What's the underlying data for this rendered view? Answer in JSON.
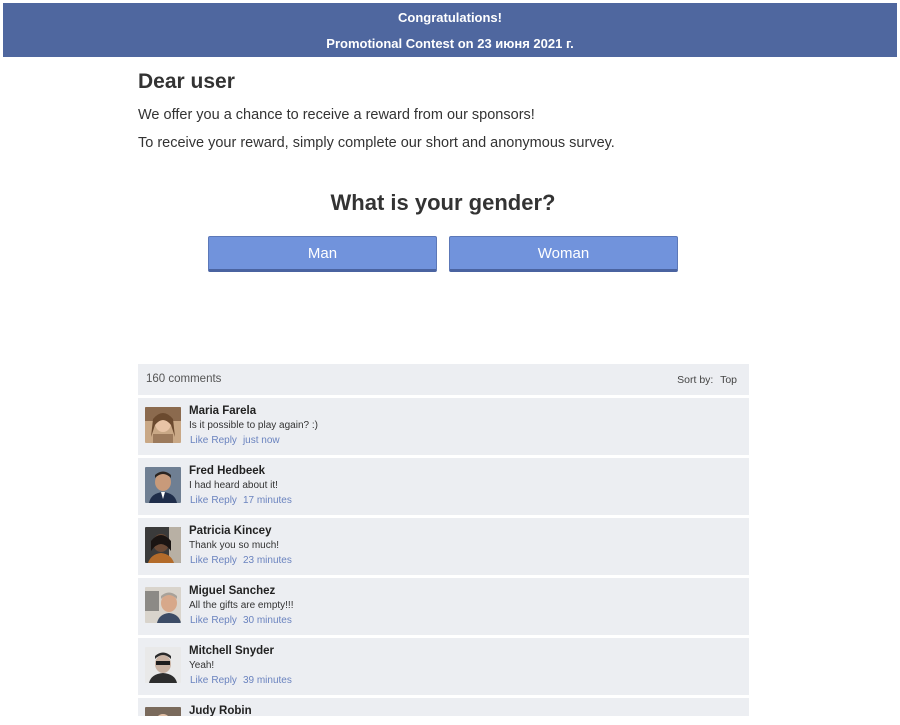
{
  "header": {
    "title": "Congratulations!",
    "subtitle": "Promotional Contest on 23 июня 2021 г."
  },
  "greeting": "Dear user",
  "intro": [
    "We offer you a chance to receive a reward from our sponsors!",
    "To receive your reward, simply complete our short and anonymous survey."
  ],
  "question": "What is your gender?",
  "answers": [
    "Man",
    "Woman"
  ],
  "colors": {
    "header_bg": "#4f679f",
    "button_bg": "#7193dc",
    "panel_bg": "#eceef2",
    "link": "#6a83bf"
  },
  "comments": {
    "count_label": "160 comments",
    "sort_label": "Sort by:",
    "sort_value": "Top",
    "like_label": "Like",
    "reply_label": "Reply",
    "items": [
      {
        "name": "Maria Farela",
        "text": "Is it possible to play again? :)",
        "time": "just now"
      },
      {
        "name": "Fred Hedbeek",
        "text": "I had heard about it!",
        "time": "17 minutes"
      },
      {
        "name": "Patricia Kincey",
        "text": "Thank you so much!",
        "time": "23 minutes"
      },
      {
        "name": "Miguel Sanchez",
        "text": "All the gifts are empty!!!",
        "time": "30 minutes"
      },
      {
        "name": "Mitchell Snyder",
        "text": "Yeah!",
        "time": "39 minutes"
      },
      {
        "name": "Judy Robin",
        "text": "",
        "time": ""
      }
    ]
  }
}
